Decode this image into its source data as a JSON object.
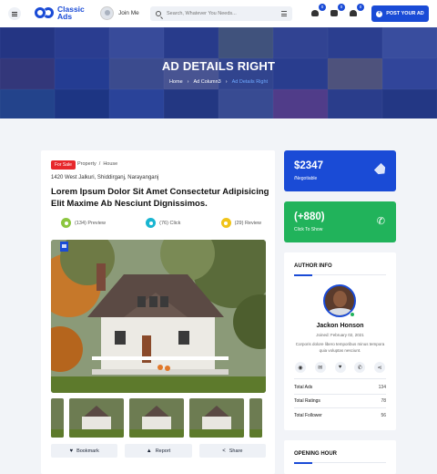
{
  "header": {
    "logo_text_1": "Classic",
    "logo_text_2": "Ads",
    "join_label": "Join Me",
    "search_placeholder": "Search, Whatever You Needs...",
    "badges": [
      "0",
      "0",
      "0"
    ],
    "post_label": "POST YOUR AD"
  },
  "hero": {
    "title": "AD DETAILS RIGHT",
    "breadcrumb": [
      "Home",
      "Ad Column3",
      "Ad Details Right"
    ]
  },
  "listing": {
    "status": "For Sale",
    "category": [
      "Property",
      "House"
    ],
    "address": "1420 West Jalkuri, Shiddirganj, Narayanganj",
    "title": "Lorem Ipsum Dolor Sit Amet Consectetur Adipisicing Elit Maxime Ab Nesciunt Dignissimos.",
    "stats": [
      {
        "value": "(134)",
        "label": "Preview",
        "color": "#8cc63f"
      },
      {
        "value": "(76)",
        "label": "Click",
        "color": "#19b5d1"
      },
      {
        "value": "(29)",
        "label": "Review",
        "color": "#f0c419"
      }
    ],
    "actions": [
      {
        "icon": "♥",
        "label": "Bookmark"
      },
      {
        "icon": "▲",
        "label": "Report"
      },
      {
        "icon": "<",
        "label": "Share"
      }
    ]
  },
  "price": {
    "amount": "$2347",
    "note": "/Negotiable"
  },
  "contact": {
    "phone": "(+880)",
    "label": "Click To Show"
  },
  "author": {
    "section_title": "AUTHOR INFO",
    "name": "Jackon Honson",
    "joined": "Joined: February 02, 2021",
    "description": "Corporis dolore libero temporibus minus tempora quia voluptas nesciunt.",
    "social_icons": [
      "globe-icon",
      "envelope-icon",
      "heart-icon",
      "phone-icon",
      "share-icon"
    ],
    "stats": [
      {
        "label": "Total Ads",
        "value": "134"
      },
      {
        "label": "Total Ratings",
        "value": "78"
      },
      {
        "label": "Total Follower",
        "value": "56"
      }
    ]
  },
  "hours": {
    "section_title": "OPENING HOUR"
  },
  "colors": {
    "primary": "#1a4bd6",
    "success": "#21b35b",
    "danger": "#e7282c"
  }
}
